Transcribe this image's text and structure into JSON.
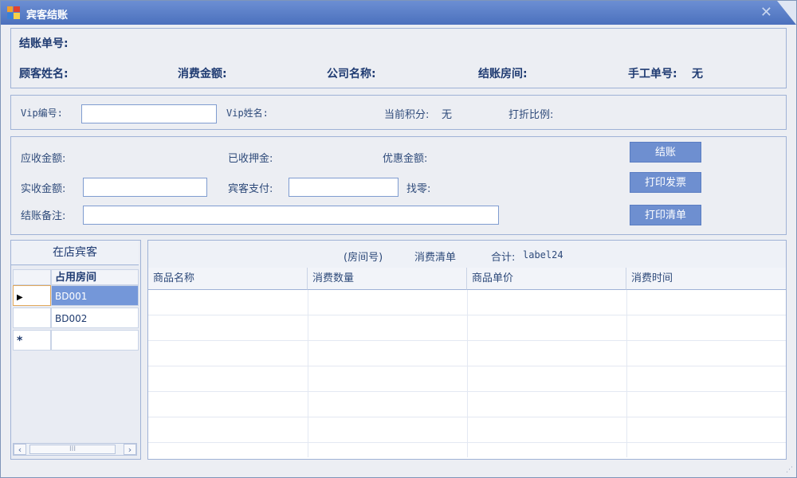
{
  "window": {
    "title": "宾客结账"
  },
  "checkout_info": {
    "checkout_no_label": "结账单号:",
    "guest_name_label": "顾客姓名:",
    "amount_label": "消费金额:",
    "company_label": "公司名称:",
    "room_label": "结账房间:",
    "manual_no_label": "手工单号:",
    "manual_no_value": "无"
  },
  "vip": {
    "vip_no_label": "Vip编号:",
    "vip_no_value": "",
    "vip_name_label": "Vip姓名:",
    "points_label": "当前积分:",
    "points_value": "无",
    "discount_label": "打折比例:"
  },
  "payment": {
    "receivable_label": "应收金额:",
    "deposit_label": "已收押金:",
    "discount_amount_label": "优惠金额:",
    "actual_label": "实收金额:",
    "actual_value": "",
    "guest_pay_label": "宾客支付:",
    "guest_pay_value": "",
    "change_label": "找零:",
    "remark_label": "结账备注:",
    "remark_value": ""
  },
  "buttons": {
    "checkout": "结账",
    "print_invoice": "打印发票",
    "print_list": "打印清单"
  },
  "guests_panel": {
    "title": "在店宾客",
    "column": "占用房间",
    "rows": [
      "BD001",
      "BD002"
    ],
    "new_row_marker": "*"
  },
  "consumption": {
    "room_label": "(房间号)",
    "list_label": "消费清单",
    "total_label": "合计:",
    "total_value": "label24",
    "columns": [
      "商品名称",
      "消费数量",
      "商品单价",
      "消费时间"
    ]
  }
}
